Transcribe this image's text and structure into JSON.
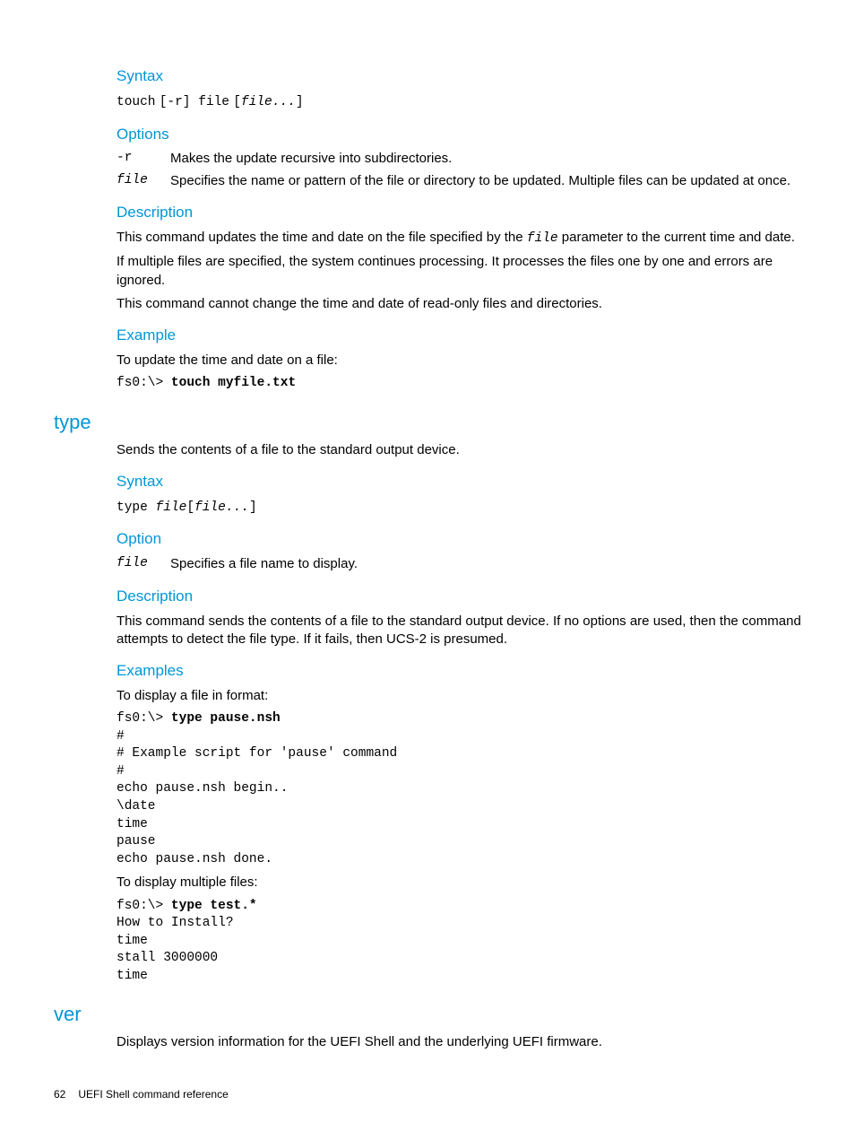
{
  "touch": {
    "h_syntax": "Syntax",
    "syntax_pre": "touch",
    "syntax_opt": "[-r] file",
    "syntax_rest_pre": "[",
    "syntax_rest_i": "file...",
    "syntax_rest_post": "]",
    "h_options": "Options",
    "opt_r_term": "-r",
    "opt_r_desc": "Makes the update recursive into subdirectories.",
    "opt_file_term": "file",
    "opt_file_desc": "Specifies the name or pattern of the file or directory to be updated. Multiple files can be updated at once.",
    "h_desc": "Description",
    "desc_p1_a": "This command updates the time and date on the file specified by the ",
    "desc_p1_code": "file",
    "desc_p1_b": " parameter to the current time and date.",
    "desc_p2": "If multiple files are specified, the system continues processing. It processes the files one by one and errors are ignored.",
    "desc_p3": "This command cannot change the time and date of read-only files and directories.",
    "h_example": "Example",
    "ex_intro": "To update the time and date on a file:",
    "ex_prompt": "fs0:\\> ",
    "ex_cmd": "touch myfile.txt"
  },
  "type": {
    "title": "type",
    "intro": "Sends the contents of a file to the standard output device.",
    "h_syntax": "Syntax",
    "syntax_pre": "type ",
    "syntax_i1": "file",
    "syntax_mid": "[",
    "syntax_i2": "file...",
    "syntax_post": "]",
    "h_option": "Option",
    "opt_file_term": "file",
    "opt_file_desc": "Specifies a file name to display.",
    "h_desc": "Description",
    "desc_p1": "This command sends the contents of a file to the standard output device. If no options are used, then the command attempts to detect the file type. If it fails, then UCS-2 is presumed.",
    "h_examples": "Examples",
    "ex1_intro": "To display a file in format:",
    "ex1_prompt": "fs0:\\> ",
    "ex1_cmd": "type pause.nsh",
    "ex1_out": "#\n# Example script for 'pause' command\n#\necho pause.nsh begin..\n\\date\ntime\npause\necho pause.nsh done.",
    "ex2_intro": "To display multiple files:",
    "ex2_prompt": "fs0:\\> ",
    "ex2_cmd": "type test.*",
    "ex2_out": "How to Install?\ntime\nstall 3000000\ntime"
  },
  "ver": {
    "title": "ver",
    "intro": "Displays version information for the UEFI Shell and the underlying UEFI firmware."
  },
  "footer": {
    "page": "62",
    "title": "UEFI Shell command reference"
  }
}
